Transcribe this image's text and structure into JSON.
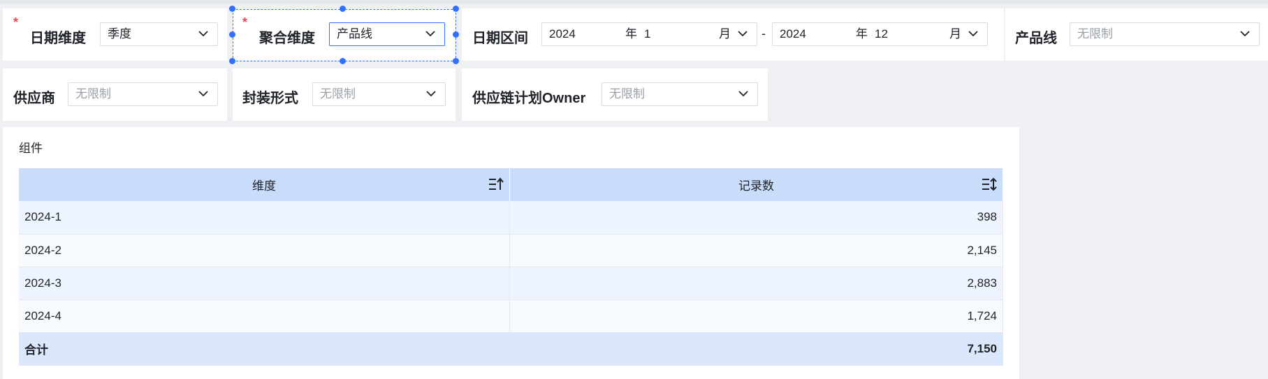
{
  "filters": {
    "date_dim": {
      "label": "日期维度",
      "value": "季度",
      "required": "*"
    },
    "agg_dim": {
      "label": "聚合维度",
      "value": "产品线",
      "required": "*"
    },
    "date_range": {
      "label": "日期区间",
      "start": {
        "year": "2024",
        "year_unit": "年",
        "month": "1",
        "month_unit": "月"
      },
      "separator": "-",
      "end": {
        "year": "2024",
        "year_unit": "年",
        "month": "12",
        "month_unit": "月"
      }
    },
    "product_line": {
      "label": "产品线",
      "placeholder": "无限制"
    },
    "supplier": {
      "label": "供应商",
      "placeholder": "无限制"
    },
    "package": {
      "label": "封装形式",
      "placeholder": "无限制"
    },
    "owner": {
      "label": "供应链计划Owner",
      "placeholder": "无限制"
    }
  },
  "component": {
    "title": "组件",
    "columns": [
      "维度",
      "记录数"
    ],
    "rows": [
      {
        "dim": "2024-1",
        "count": "398"
      },
      {
        "dim": "2024-2",
        "count": "2,145"
      },
      {
        "dim": "2024-3",
        "count": "2,883"
      },
      {
        "dim": "2024-4",
        "count": "1,724"
      }
    ],
    "total": {
      "label": "合计",
      "count": "7,150"
    }
  },
  "colors": {
    "accent": "#3370ff",
    "header_bg": "#c9dcfa",
    "required": "#e34d59"
  }
}
